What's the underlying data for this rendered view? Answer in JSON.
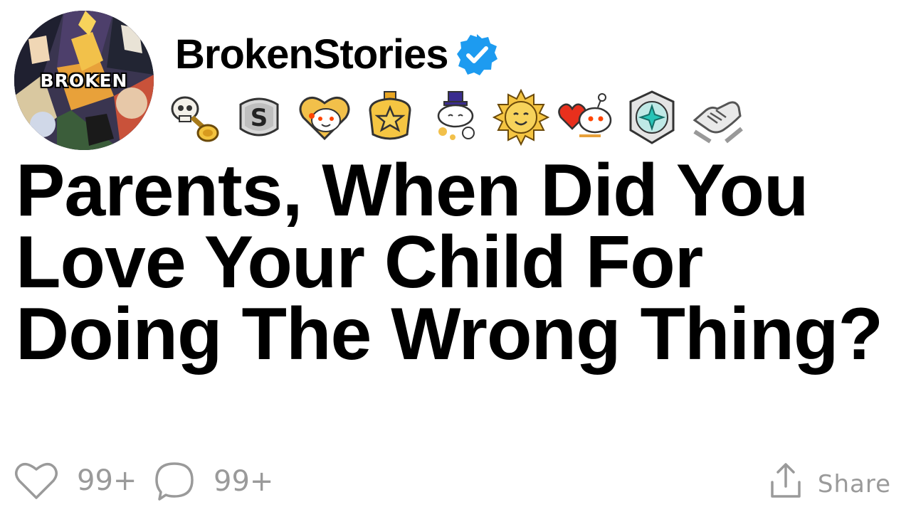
{
  "post": {
    "author": {
      "name": "BrokenStories",
      "avatar_text": "BROKEN",
      "verified_color": "#1d9bf0",
      "avatar_icon": "anime-collage-avatar"
    },
    "awards": [
      {
        "icon": "skull-trumpet-award-icon"
      },
      {
        "icon": "silver-s-award-icon"
      },
      {
        "icon": "heart-snoo-award-icon"
      },
      {
        "icon": "gold-star-award-icon"
      },
      {
        "icon": "snoo-top-hat-award-icon"
      },
      {
        "icon": "sun-face-award-icon"
      },
      {
        "icon": "snoo-heart-award-icon"
      },
      {
        "icon": "platinum-award-icon"
      },
      {
        "icon": "handshake-award-icon"
      }
    ],
    "title": "Parents, When Did You Love Your Child For Doing The Wrong Thing?",
    "stats": {
      "likes": "99+",
      "comments": "99+"
    },
    "share_label": "Share"
  },
  "colors": {
    "text": "#000000",
    "muted": "#9a9a9a",
    "verified": "#1d9bf0"
  }
}
